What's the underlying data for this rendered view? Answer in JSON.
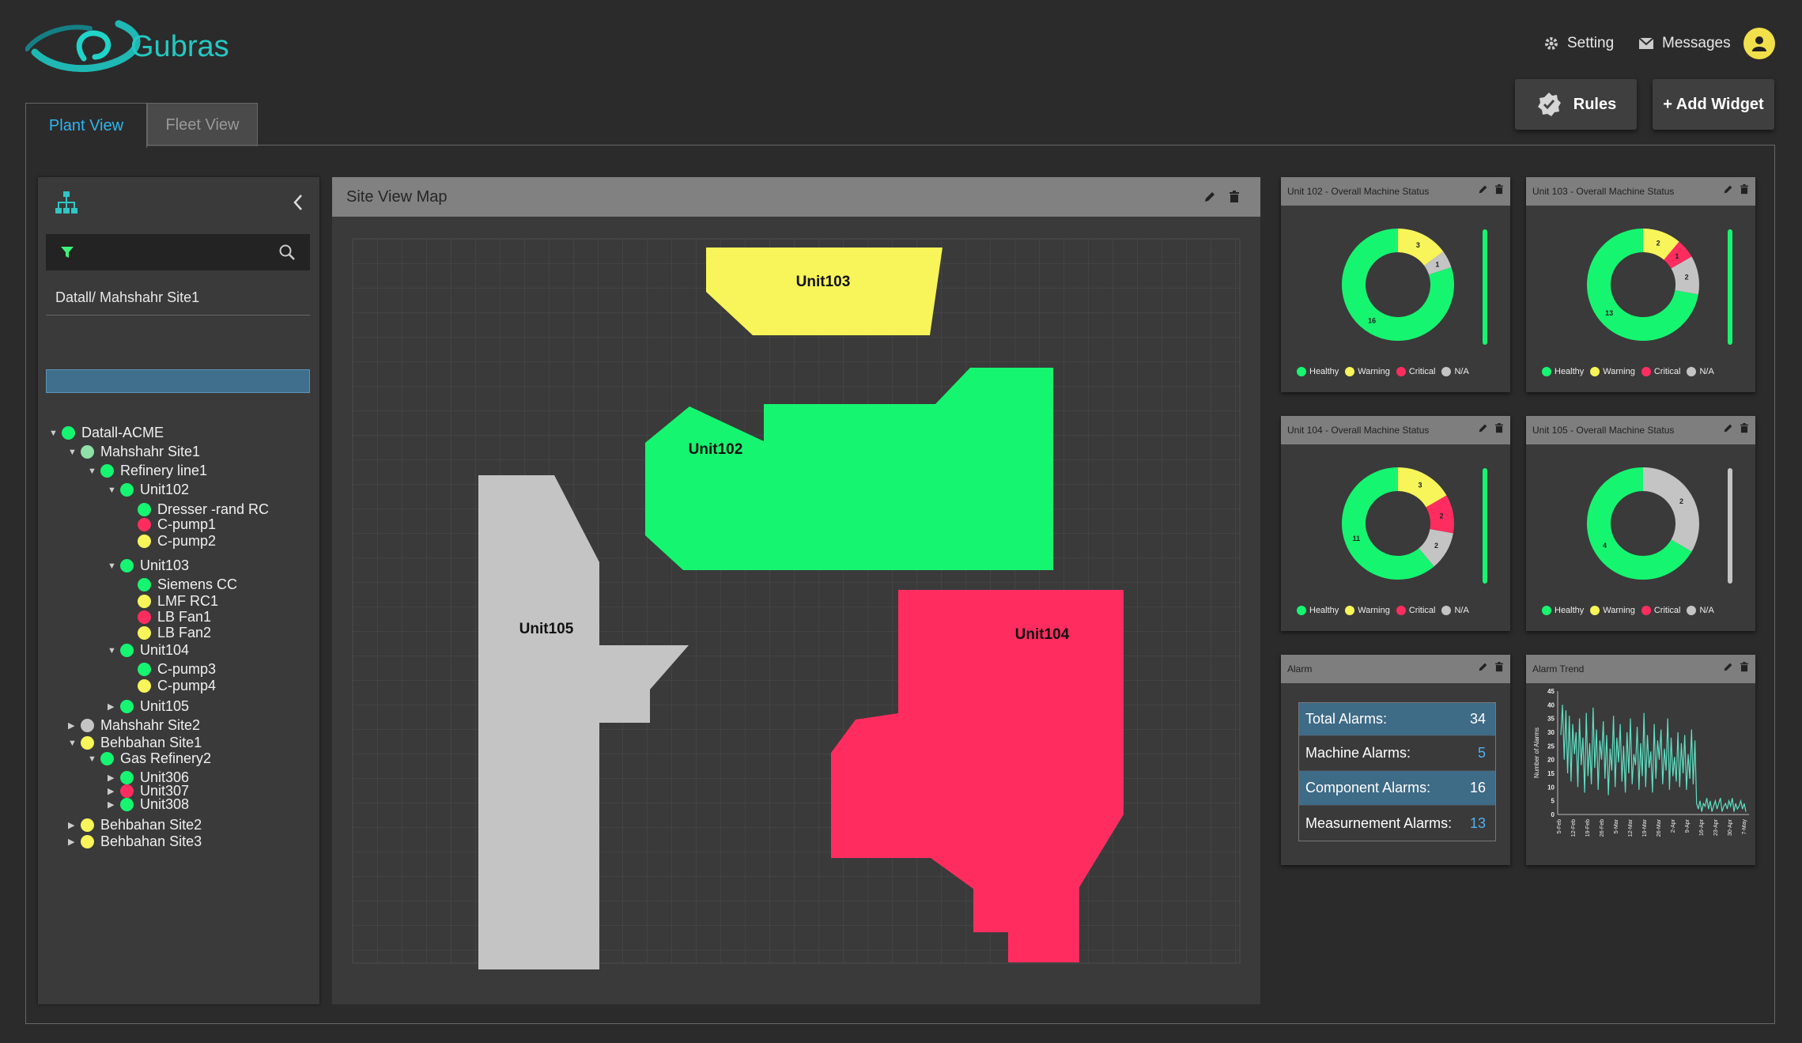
{
  "app": {
    "name": "Gubras"
  },
  "header": {
    "setting_label": "Setting",
    "messages_label": "Messages"
  },
  "toolbar": {
    "rules_label": "Rules",
    "add_widget_label": "+ Add Widget"
  },
  "tabs": [
    {
      "label": "Plant View",
      "active": true
    },
    {
      "label": "Fleet View",
      "active": false
    }
  ],
  "tree": {
    "breadcrumb": "Datall/ Mahshahr Site1",
    "nodes": [
      {
        "label": "Datall-ACME",
        "status": "healthy",
        "expanded": true
      },
      {
        "label": "Mahshahr Site1",
        "status": "healthy-light",
        "expanded": true,
        "selected": true
      },
      {
        "label": "Refinery line1",
        "status": "healthy",
        "expanded": true
      },
      {
        "label": "Unit102",
        "status": "healthy",
        "expanded": true
      },
      {
        "label": "Dresser -rand  RC",
        "status": "healthy"
      },
      {
        "label": "C-pump1",
        "status": "critical"
      },
      {
        "label": "C-pump2",
        "status": "warning"
      },
      {
        "label": "Unit103",
        "status": "healthy",
        "expanded": true
      },
      {
        "label": "Siemens CC",
        "status": "healthy"
      },
      {
        "label": "LMF RC1",
        "status": "warning"
      },
      {
        "label": "LB Fan1",
        "status": "critical"
      },
      {
        "label": "LB Fan2",
        "status": "warning"
      },
      {
        "label": "Unit104",
        "status": "healthy",
        "expanded": true
      },
      {
        "label": "C-pump3",
        "status": "healthy"
      },
      {
        "label": "C-pump4",
        "status": "warning"
      },
      {
        "label": "Unit105",
        "status": "healthy",
        "expanded": false
      },
      {
        "label": "Mahshahr Site2",
        "status": "na",
        "expanded": false
      },
      {
        "label": "Behbahan Site1",
        "status": "warning",
        "expanded": true
      },
      {
        "label": "Gas Refinery2",
        "status": "healthy",
        "expanded": true
      },
      {
        "label": "Unit306",
        "status": "healthy",
        "expanded": false
      },
      {
        "label": "Unit307",
        "status": "critical",
        "expanded": false
      },
      {
        "label": "Unit308",
        "status": "healthy",
        "expanded": false
      },
      {
        "label": "Behbahan Site2",
        "status": "warning",
        "expanded": false
      },
      {
        "label": "Behbahan Site3",
        "status": "warning",
        "expanded": false
      }
    ]
  },
  "map": {
    "title": "Site View Map",
    "units": [
      {
        "label": "Unit103",
        "status": "warning"
      },
      {
        "label": "Unit102",
        "status": "healthy"
      },
      {
        "label": "Unit105",
        "status": "na"
      },
      {
        "label": "Unit104",
        "status": "critical"
      }
    ]
  },
  "status_colors": {
    "healthy": "#16f570",
    "warning": "#f7f559",
    "critical": "#ff2d5f",
    "na": "#c4c4c4"
  },
  "legend": {
    "healthy": "Healthy",
    "warning": "Warning",
    "critical": "Critical",
    "na": "N/A"
  },
  "widgets": {
    "status": [
      {
        "title": "Unit 102 - Overall Machine Status",
        "healthy": 16,
        "warning": 3,
        "critical": 0,
        "na": 1,
        "bar_status": "healthy"
      },
      {
        "title": "Unit 103 - Overall Machine Status",
        "healthy": 13,
        "warning": 2,
        "critical": 1,
        "na": 2,
        "bar_status": "healthy"
      },
      {
        "title": "Unit 104 - Overall Machine Status",
        "healthy": 11,
        "warning": 3,
        "critical": 2,
        "na": 2,
        "bar_status": "healthy"
      },
      {
        "title": "Unit 105 - Overall Machine Status",
        "healthy": 4,
        "warning": 0,
        "critical": 0,
        "na": 2,
        "bar_status": "na"
      }
    ],
    "alarm": {
      "title": "Alarm",
      "rows": [
        {
          "label": "Total Alarms:",
          "value": "34"
        },
        {
          "label": "Machine Alarms:",
          "value": "5"
        },
        {
          "label": "Component Alarms:",
          "value": "16"
        },
        {
          "label": "Measurnement Alarms:",
          "value": "13"
        }
      ]
    },
    "trend": {
      "title": "Alarm Trend"
    }
  },
  "chart_data": {
    "type": "line",
    "ylabel": "Number of Alarms",
    "ylim": [
      0,
      45
    ],
    "yticks": [
      0,
      5,
      10,
      15,
      20,
      25,
      30,
      35,
      40,
      45
    ],
    "xticks": [
      "5-Feb",
      "12-Feb",
      "19-Feb",
      "26-Feb",
      "5-Mar",
      "12-Mar",
      "19-Mar",
      "26-Mar",
      "2-Apr",
      "9-Apr",
      "16-Apr",
      "23-Apr",
      "30-Apr",
      "7-May"
    ],
    "series": [
      {
        "values": [
          29,
          40,
          20,
          38,
          15,
          36,
          12,
          33,
          22,
          30,
          10,
          35,
          18,
          28,
          8,
          37,
          14,
          26,
          11,
          39,
          17,
          31,
          9,
          27,
          20,
          34,
          13,
          29,
          7,
          24,
          16,
          36,
          10,
          28,
          19,
          33,
          12,
          25,
          8,
          30,
          15,
          35,
          11,
          22,
          18,
          32,
          9,
          26,
          14,
          37,
          10,
          29,
          17,
          23,
          8,
          33,
          13,
          27,
          20,
          31,
          11,
          24,
          16,
          35,
          9,
          28,
          14,
          21,
          12,
          30,
          10,
          26,
          15,
          29,
          9,
          22,
          13,
          31,
          11,
          27,
          4,
          2,
          5,
          1,
          4,
          3,
          6,
          2,
          5,
          1,
          3,
          5,
          2,
          4,
          6,
          1,
          3,
          4,
          2,
          5,
          3,
          6,
          1,
          4,
          2,
          3,
          5,
          2,
          4,
          1
        ]
      }
    ]
  }
}
